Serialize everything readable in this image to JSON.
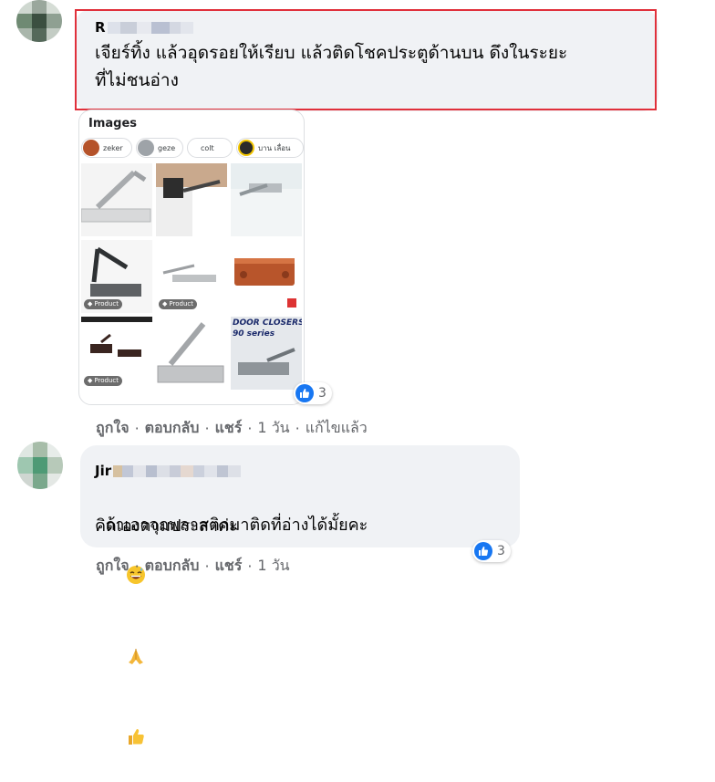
{
  "comment1": {
    "author": "R",
    "text_line1": "เจียร์ทิ้ง แล้วอุดรอยให้เรียบ แล้วติดโชคประตูด้านบน ดึงในระยะ",
    "text_line2": "ที่ไม่ชนอ่าง",
    "image_card": {
      "title": "Images",
      "chips": [
        "zeker",
        "geze",
        "colt",
        "บาน เลื่อน"
      ],
      "product_tag": "Product",
      "banner_line1": "DOOR CLOSERS",
      "banner_line2": "90 series"
    },
    "reaction_count": "3",
    "actions": {
      "like": "ถูกใจ",
      "reply": "ตอบกลับ",
      "share": "แชร์",
      "time": "1 วัน",
      "edited": "แก้ไขแล้ว"
    }
  },
  "comment2": {
    "author": "Jir",
    "text_line1": "ถ้าเอาจุกพลาสติกมาติดที่อ่างได้มั้ยคะ",
    "text_line2": "คิดเองตามประสาค่ะ",
    "reaction_count": "3",
    "actions": {
      "like": "ถูกใจ",
      "reply": "ตอบกลับ",
      "share": "แชร์",
      "time": "1 วัน"
    }
  },
  "icons": {
    "like_reaction": "thumbs-up-icon",
    "emoji_1": "grinning-sweat-emoji",
    "emoji_2": "folded-hands-emoji",
    "emoji_3": "thumbs-up-emoji",
    "product_tag": "tag-icon"
  },
  "colors": {
    "bubble": "#f0f2f5",
    "highlight_box": "#e0303b",
    "like_blue": "#1877f2",
    "meta_gray": "#65676b"
  }
}
